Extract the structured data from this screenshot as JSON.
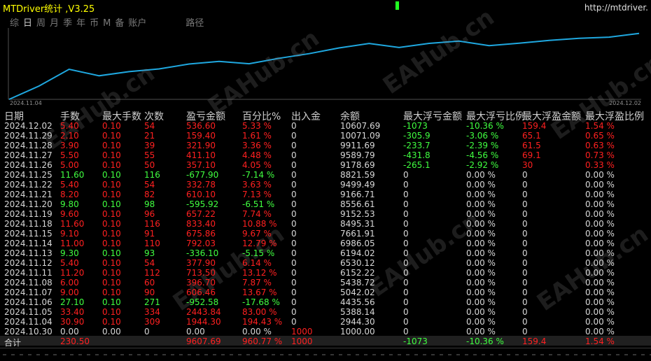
{
  "header": {
    "title": "MTDriver统计 ,V3.25",
    "url": "http://mtdriver."
  },
  "tabs": [
    "综",
    "日",
    "周",
    "月",
    "季",
    "年",
    "币",
    "M",
    "备",
    "账户"
  ],
  "active_tab": "日",
  "path_label": "路径",
  "chart": {
    "start_date": "2024.11.04",
    "end_date": "2024.12.02",
    "line_color": "#1fa8e0"
  },
  "watermark": "EAHub.cn",
  "columns": [
    "日期",
    "手数",
    "最大手数",
    "次数",
    "盈亏金额",
    "百分比%",
    "出入金",
    "余额",
    "最大浮亏金额",
    "最大浮亏比例",
    "最大浮盈金额",
    "最大浮盈比例"
  ],
  "rows": [
    {
      "date": "2024.12.02",
      "lots": "5.40",
      "max_lots": "0.10",
      "count": "54",
      "pnl": "536.60",
      "pct": "5.33 %",
      "flow": "0",
      "balance": "10607.69",
      "fl_amt": "-1073",
      "fl_pct": "-10.36 %",
      "fp_amt": "159.4",
      "fp_pct": "1.54 %",
      "c": "red"
    },
    {
      "date": "2024.11.29",
      "lots": "2.10",
      "max_lots": "0.10",
      "count": "21",
      "pnl": "159.40",
      "pct": "1.61 %",
      "flow": "0",
      "balance": "10071.09",
      "fl_amt": "-305.9",
      "fl_pct": "-3.06 %",
      "fp_amt": "65.1",
      "fp_pct": "0.65 %",
      "c": "red"
    },
    {
      "date": "2024.11.28",
      "lots": "3.90",
      "max_lots": "0.10",
      "count": "39",
      "pnl": "321.90",
      "pct": "3.36 %",
      "flow": "0",
      "balance": "9911.69",
      "fl_amt": "-233.7",
      "fl_pct": "-2.39 %",
      "fp_amt": "61.5",
      "fp_pct": "0.63 %",
      "c": "red"
    },
    {
      "date": "2024.11.27",
      "lots": "5.50",
      "max_lots": "0.10",
      "count": "55",
      "pnl": "411.10",
      "pct": "4.48 %",
      "flow": "0",
      "balance": "9589.79",
      "fl_amt": "-431.8",
      "fl_pct": "-4.56 %",
      "fp_amt": "69.1",
      "fp_pct": "0.73 %",
      "c": "red"
    },
    {
      "date": "2024.11.26",
      "lots": "5.00",
      "max_lots": "0.10",
      "count": "50",
      "pnl": "357.10",
      "pct": "4.05 %",
      "flow": "0",
      "balance": "9178.69",
      "fl_amt": "-265.1",
      "fl_pct": "-2.92 %",
      "fp_amt": "30",
      "fp_pct": "0.33 %",
      "c": "red"
    },
    {
      "date": "2024.11.25",
      "lots": "11.60",
      "max_lots": "0.10",
      "count": "116",
      "pnl": "-677.90",
      "pct": "-7.14 %",
      "flow": "0",
      "balance": "8821.59",
      "fl_amt": "0",
      "fl_pct": "0.00 %",
      "fp_amt": "0",
      "fp_pct": "0.00 %",
      "c": "green"
    },
    {
      "date": "2024.11.22",
      "lots": "5.40",
      "max_lots": "0.10",
      "count": "54",
      "pnl": "332.78",
      "pct": "3.63 %",
      "flow": "0",
      "balance": "9499.49",
      "fl_amt": "0",
      "fl_pct": "0.00 %",
      "fp_amt": "0",
      "fp_pct": "0.00 %",
      "c": "red"
    },
    {
      "date": "2024.11.21",
      "lots": "8.20",
      "max_lots": "0.10",
      "count": "82",
      "pnl": "610.10",
      "pct": "7.13 %",
      "flow": "0",
      "balance": "9166.71",
      "fl_amt": "0",
      "fl_pct": "0.00 %",
      "fp_amt": "0",
      "fp_pct": "0.00 %",
      "c": "red"
    },
    {
      "date": "2024.11.20",
      "lots": "9.80",
      "max_lots": "0.10",
      "count": "98",
      "pnl": "-595.92",
      "pct": "-6.51 %",
      "flow": "0",
      "balance": "8556.61",
      "fl_amt": "0",
      "fl_pct": "0.00 %",
      "fp_amt": "0",
      "fp_pct": "0.00 %",
      "c": "green"
    },
    {
      "date": "2024.11.19",
      "lots": "9.60",
      "max_lots": "0.10",
      "count": "96",
      "pnl": "657.22",
      "pct": "7.74 %",
      "flow": "0",
      "balance": "9152.53",
      "fl_amt": "0",
      "fl_pct": "0.00 %",
      "fp_amt": "0",
      "fp_pct": "0.00 %",
      "c": "red"
    },
    {
      "date": "2024.11.18",
      "lots": "11.60",
      "max_lots": "0.10",
      "count": "116",
      "pnl": "833.40",
      "pct": "10.88 %",
      "flow": "0",
      "balance": "8495.31",
      "fl_amt": "0",
      "fl_pct": "0.00 %",
      "fp_amt": "0",
      "fp_pct": "0.00 %",
      "c": "red"
    },
    {
      "date": "2024.11.15",
      "lots": "9.10",
      "max_lots": "0.10",
      "count": "91",
      "pnl": "675.86",
      "pct": "9.67 %",
      "flow": "0",
      "balance": "7661.91",
      "fl_amt": "0",
      "fl_pct": "0.00 %",
      "fp_amt": "0",
      "fp_pct": "0.00 %",
      "c": "red"
    },
    {
      "date": "2024.11.14",
      "lots": "11.00",
      "max_lots": "0.10",
      "count": "110",
      "pnl": "792.03",
      "pct": "12.79 %",
      "flow": "0",
      "balance": "6986.05",
      "fl_amt": "0",
      "fl_pct": "0.00 %",
      "fp_amt": "0",
      "fp_pct": "0.00 %",
      "c": "red"
    },
    {
      "date": "2024.11.13",
      "lots": "9.30",
      "max_lots": "0.10",
      "count": "93",
      "pnl": "-336.10",
      "pct": "-5.15 %",
      "flow": "0",
      "balance": "6194.02",
      "fl_amt": "0",
      "fl_pct": "0.00 %",
      "fp_amt": "0",
      "fp_pct": "0.00 %",
      "c": "green"
    },
    {
      "date": "2024.11.12",
      "lots": "5.40",
      "max_lots": "0.10",
      "count": "54",
      "pnl": "377.90",
      "pct": "6.14 %",
      "flow": "0",
      "balance": "6530.12",
      "fl_amt": "0",
      "fl_pct": "0.00 %",
      "fp_amt": "0",
      "fp_pct": "0.00 %",
      "c": "red"
    },
    {
      "date": "2024.11.11",
      "lots": "11.20",
      "max_lots": "0.10",
      "count": "112",
      "pnl": "713.50",
      "pct": "13.12 %",
      "flow": "0",
      "balance": "6152.22",
      "fl_amt": "0",
      "fl_pct": "0.00 %",
      "fp_amt": "0",
      "fp_pct": "0.00 %",
      "c": "red"
    },
    {
      "date": "2024.11.08",
      "lots": "6.00",
      "max_lots": "0.10",
      "count": "60",
      "pnl": "396.70",
      "pct": "7.87 %",
      "flow": "0",
      "balance": "5438.72",
      "fl_amt": "0",
      "fl_pct": "0.00 %",
      "fp_amt": "0",
      "fp_pct": "0.00 %",
      "c": "red"
    },
    {
      "date": "2024.11.07",
      "lots": "9.00",
      "max_lots": "0.10",
      "count": "90",
      "pnl": "606.46",
      "pct": "13.67 %",
      "flow": "0",
      "balance": "5042.02",
      "fl_amt": "0",
      "fl_pct": "0.00 %",
      "fp_amt": "0",
      "fp_pct": "0.00 %",
      "c": "red"
    },
    {
      "date": "2024.11.06",
      "lots": "27.10",
      "max_lots": "0.10",
      "count": "271",
      "pnl": "-952.58",
      "pct": "-17.68 %",
      "flow": "0",
      "balance": "4435.56",
      "fl_amt": "0",
      "fl_pct": "0.00 %",
      "fp_amt": "0",
      "fp_pct": "0.00 %",
      "c": "green"
    },
    {
      "date": "2024.11.05",
      "lots": "33.40",
      "max_lots": "0.10",
      "count": "334",
      "pnl": "2443.84",
      "pct": "83.00 %",
      "flow": "0",
      "balance": "5388.14",
      "fl_amt": "0",
      "fl_pct": "0.00 %",
      "fp_amt": "0",
      "fp_pct": "0.00 %",
      "c": "red"
    },
    {
      "date": "2024.11.04",
      "lots": "30.90",
      "max_lots": "0.10",
      "count": "309",
      "pnl": "1944.30",
      "pct": "194.43 %",
      "flow": "0",
      "balance": "2944.30",
      "fl_amt": "0",
      "fl_pct": "0.00 %",
      "fp_amt": "0",
      "fp_pct": "0.00 %",
      "c": "red"
    },
    {
      "date": "2024.10.30",
      "lots": "0.00",
      "max_lots": "0.00",
      "count": "0",
      "pnl": "0.00",
      "pct": "0.00 %",
      "flow": "1000",
      "balance": "1000.00",
      "fl_amt": "0",
      "fl_pct": "0.00 %",
      "fp_amt": "0",
      "fp_pct": "0.00 %",
      "c": "white"
    }
  ],
  "total": {
    "label": "合计",
    "lots": "230.50",
    "pnl": "9607.69",
    "pct": "960.77 %",
    "flow": "1000",
    "fl_amt": "-1073",
    "fl_pct": "-10.36 %",
    "fp_amt": "159.4",
    "fp_pct": "1.54 %"
  },
  "colors": {
    "profit": "#ff2020",
    "loss": "#40ff40",
    "neutral": "#d8d8d8",
    "title": "#ffff00"
  }
}
